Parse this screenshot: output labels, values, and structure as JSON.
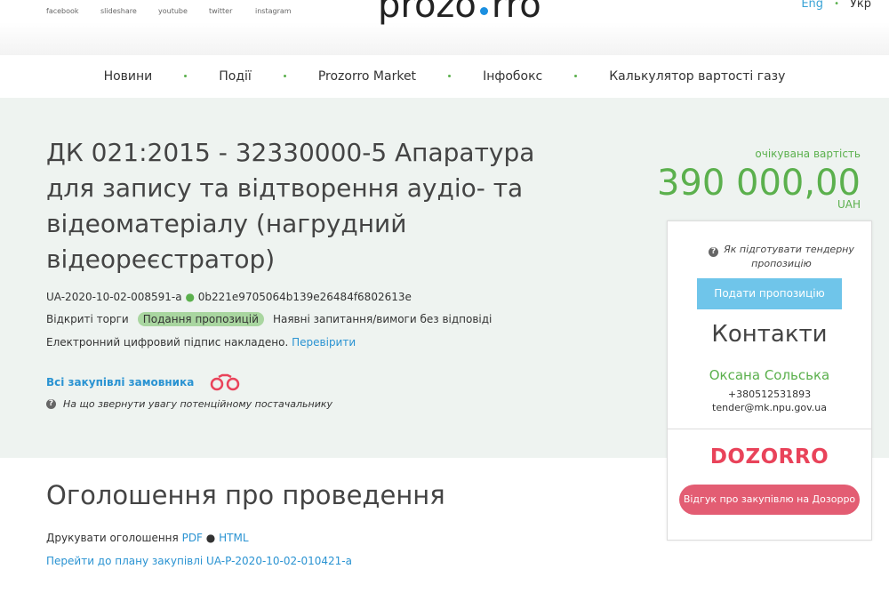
{
  "header": {
    "social": [
      {
        "label": "facebook",
        "icon": "facebook-icon"
      },
      {
        "label": "slideshare",
        "icon": "slideshare-icon"
      },
      {
        "label": "youtube",
        "icon": "youtube-icon"
      },
      {
        "label": "twitter",
        "icon": "twitter-icon"
      },
      {
        "label": "instagram",
        "icon": "instagram-icon"
      }
    ],
    "logo_left": "prozo",
    "logo_right": "rro",
    "lang_eng": "Eng",
    "lang_ukr": "Укр"
  },
  "nav": {
    "items": [
      "Новини",
      "Події",
      "Prozorro Market",
      "Інфобокс",
      "Калькулятор вартості газу"
    ]
  },
  "tender": {
    "title": "ДК 021:2015 - 32330000-5 Апаратура для запису та відтворення аудіо- та відеоматеріалу (нагрудний відеореєстратор)",
    "id": "UA-2020-10-02-008591-a",
    "hash": "0b221e9705064b139e26484f6802613e",
    "procedure": "Відкриті торги",
    "status": "Подання пропозицій",
    "questions": "Наявні запитання/вимоги без відповіді",
    "signature_text": "Електронний цифровий підпис накладено.",
    "signature_link": "Перевірити",
    "all_procurements": "Всі закупівлі замовника",
    "attention": "На що звернути увагу потенційному постачальнику",
    "expected_label": "очікувана вартість",
    "expected_amount": "390 000,00",
    "currency": "UAH"
  },
  "card": {
    "how_to": "Як підготувати тендерну пропозицію",
    "submit": "Подати пропозицію",
    "contacts_title": "Контакти",
    "contact_name": "Оксана Сольська",
    "contact_phone": "+380512531893",
    "contact_email": "tender@mk.npu.gov.ua",
    "dozorro": "DOZORRO",
    "dozorro_button": "Відгук про закупівлю на Дозорро"
  },
  "announcement": {
    "title": "Оголошення про проведення",
    "print_label": "Друкувати оголошення",
    "pdf": "PDF",
    "html": "HTML",
    "plan_link": "Перейти до плану закупівлі UA-P-2020-10-02-010421-a"
  },
  "colors": {
    "accent_green": "#5bb04d",
    "link_blue": "#2a93d2",
    "dozorro_red": "#e9435a",
    "hero_bg": "#eef3f0"
  }
}
